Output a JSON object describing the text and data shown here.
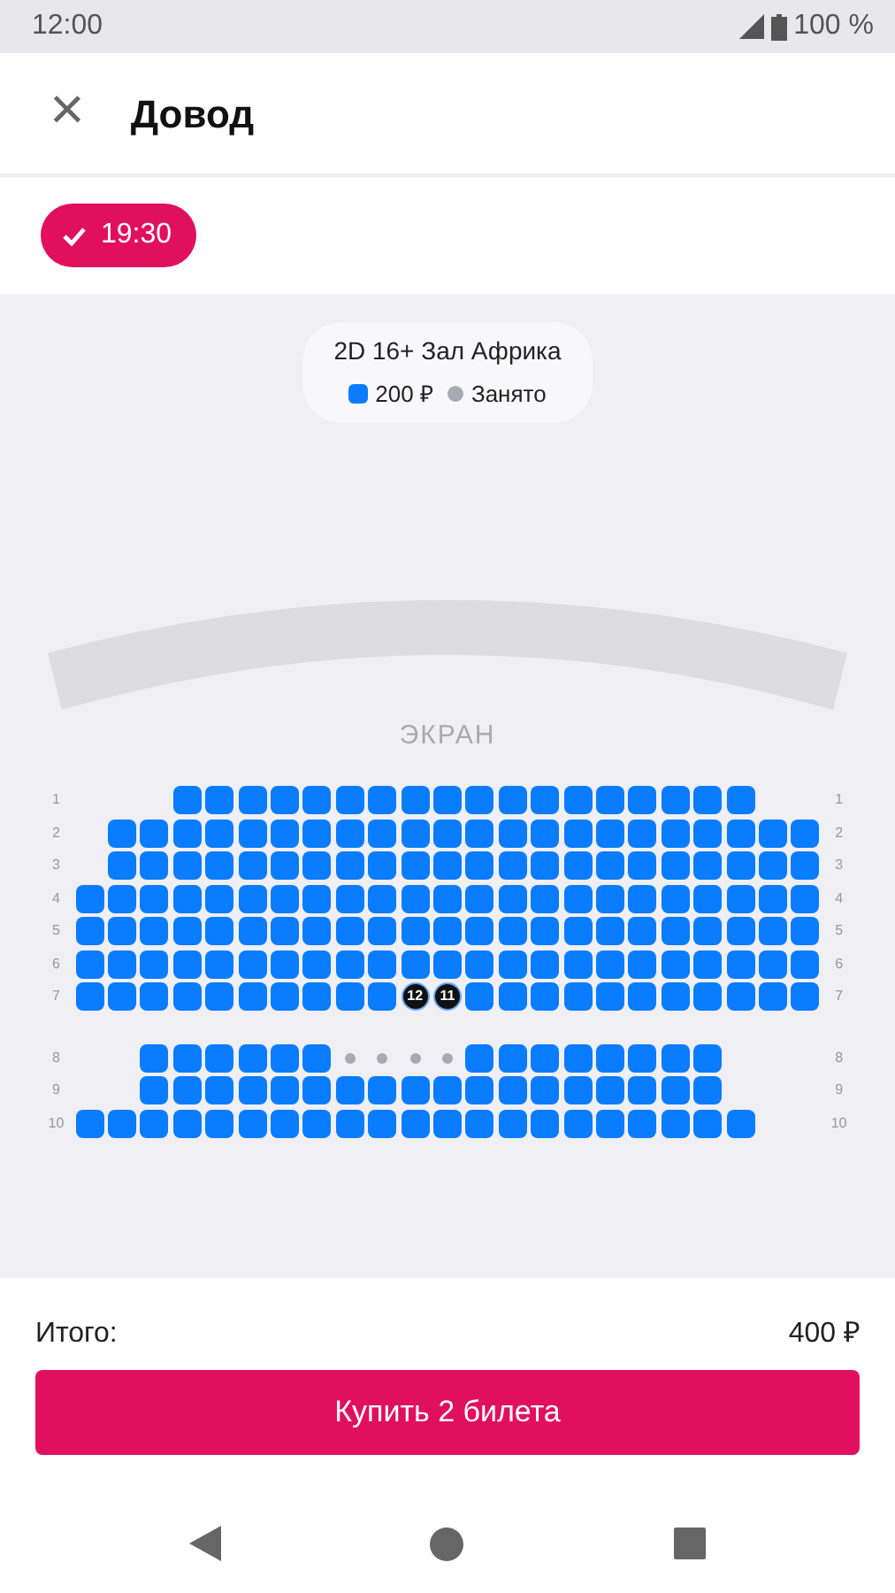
{
  "status_bar": {
    "time": "12:00",
    "battery": "100 %"
  },
  "header": {
    "close": "×",
    "title": "Довод"
  },
  "sessions": [
    {
      "time": "19:30",
      "selected": true
    }
  ],
  "hall_info": {
    "title": "2D 16+ Зал Африка",
    "legend": [
      {
        "kind": "price",
        "label": "200 ₽",
        "color": "#0a7cff"
      },
      {
        "kind": "taken",
        "label": "Занято",
        "color": "#a9a9b3"
      }
    ]
  },
  "screen_label": "ЭКРАН",
  "sections": [
    {
      "rows": [
        {
          "left_label": "1",
          "right_label": "1",
          "seats": [
            {
              "kind": "gap"
            },
            {
              "kind": "gap"
            },
            {
              "kind": "gap"
            },
            {
              "kind": "free"
            },
            {
              "kind": "free"
            },
            {
              "kind": "free"
            },
            {
              "kind": "free"
            },
            {
              "kind": "free"
            },
            {
              "kind": "free"
            },
            {
              "kind": "free"
            },
            {
              "kind": "free"
            },
            {
              "kind": "free"
            },
            {
              "kind": "free"
            },
            {
              "kind": "free"
            },
            {
              "kind": "free"
            },
            {
              "kind": "free"
            },
            {
              "kind": "free"
            },
            {
              "kind": "free"
            },
            {
              "kind": "free"
            },
            {
              "kind": "free"
            },
            {
              "kind": "free"
            }
          ]
        },
        {
          "left_label": "2",
          "right_label": "2",
          "seats": [
            {
              "kind": "gap"
            },
            {
              "kind": "free"
            },
            {
              "kind": "free"
            },
            {
              "kind": "free"
            },
            {
              "kind": "free"
            },
            {
              "kind": "free"
            },
            {
              "kind": "free"
            },
            {
              "kind": "free"
            },
            {
              "kind": "free"
            },
            {
              "kind": "free"
            },
            {
              "kind": "free"
            },
            {
              "kind": "free"
            },
            {
              "kind": "free"
            },
            {
              "kind": "free"
            },
            {
              "kind": "free"
            },
            {
              "kind": "free"
            },
            {
              "kind": "free"
            },
            {
              "kind": "free"
            },
            {
              "kind": "free"
            },
            {
              "kind": "free"
            },
            {
              "kind": "free"
            },
            {
              "kind": "free"
            },
            {
              "kind": "free"
            }
          ]
        },
        {
          "left_label": "3",
          "right_label": "3",
          "seats": [
            {
              "kind": "gap"
            },
            {
              "kind": "free"
            },
            {
              "kind": "free"
            },
            {
              "kind": "free"
            },
            {
              "kind": "free"
            },
            {
              "kind": "free"
            },
            {
              "kind": "free"
            },
            {
              "kind": "free"
            },
            {
              "kind": "free"
            },
            {
              "kind": "free"
            },
            {
              "kind": "free"
            },
            {
              "kind": "free"
            },
            {
              "kind": "free"
            },
            {
              "kind": "free"
            },
            {
              "kind": "free"
            },
            {
              "kind": "free"
            },
            {
              "kind": "free"
            },
            {
              "kind": "free"
            },
            {
              "kind": "free"
            },
            {
              "kind": "free"
            },
            {
              "kind": "free"
            },
            {
              "kind": "free"
            },
            {
              "kind": "free"
            }
          ]
        },
        {
          "left_label": "4",
          "right_label": "4",
          "seats": [
            {
              "kind": "free"
            },
            {
              "kind": "free"
            },
            {
              "kind": "free"
            },
            {
              "kind": "free"
            },
            {
              "kind": "free"
            },
            {
              "kind": "free"
            },
            {
              "kind": "free"
            },
            {
              "kind": "free"
            },
            {
              "kind": "free"
            },
            {
              "kind": "free"
            },
            {
              "kind": "free"
            },
            {
              "kind": "free"
            },
            {
              "kind": "free"
            },
            {
              "kind": "free"
            },
            {
              "kind": "free"
            },
            {
              "kind": "free"
            },
            {
              "kind": "free"
            },
            {
              "kind": "free"
            },
            {
              "kind": "free"
            },
            {
              "kind": "free"
            },
            {
              "kind": "free"
            },
            {
              "kind": "free"
            },
            {
              "kind": "free"
            }
          ]
        },
        {
          "left_label": "5",
          "right_label": "5",
          "seats": [
            {
              "kind": "free"
            },
            {
              "kind": "free"
            },
            {
              "kind": "free"
            },
            {
              "kind": "free"
            },
            {
              "kind": "free"
            },
            {
              "kind": "free"
            },
            {
              "kind": "free"
            },
            {
              "kind": "free"
            },
            {
              "kind": "free"
            },
            {
              "kind": "free"
            },
            {
              "kind": "free"
            },
            {
              "kind": "free"
            },
            {
              "kind": "free"
            },
            {
              "kind": "free"
            },
            {
              "kind": "free"
            },
            {
              "kind": "free"
            },
            {
              "kind": "free"
            },
            {
              "kind": "free"
            },
            {
              "kind": "free"
            },
            {
              "kind": "free"
            },
            {
              "kind": "free"
            },
            {
              "kind": "free"
            },
            {
              "kind": "free"
            }
          ]
        },
        {
          "left_label": "6",
          "right_label": "6",
          "seats": [
            {
              "kind": "free"
            },
            {
              "kind": "free"
            },
            {
              "kind": "free"
            },
            {
              "kind": "free"
            },
            {
              "kind": "free"
            },
            {
              "kind": "free"
            },
            {
              "kind": "free"
            },
            {
              "kind": "free"
            },
            {
              "kind": "free"
            },
            {
              "kind": "free"
            },
            {
              "kind": "free"
            },
            {
              "kind": "free"
            },
            {
              "kind": "free"
            },
            {
              "kind": "free"
            },
            {
              "kind": "free"
            },
            {
              "kind": "free"
            },
            {
              "kind": "free"
            },
            {
              "kind": "free"
            },
            {
              "kind": "free"
            },
            {
              "kind": "free"
            },
            {
              "kind": "free"
            },
            {
              "kind": "free"
            },
            {
              "kind": "free"
            }
          ]
        },
        {
          "left_label": "7",
          "right_label": "7",
          "seats": [
            {
              "kind": "free"
            },
            {
              "kind": "free"
            },
            {
              "kind": "free"
            },
            {
              "kind": "free"
            },
            {
              "kind": "free"
            },
            {
              "kind": "free"
            },
            {
              "kind": "free"
            },
            {
              "kind": "free"
            },
            {
              "kind": "free"
            },
            {
              "kind": "free"
            },
            {
              "kind": "selected",
              "number": "12"
            },
            {
              "kind": "selected",
              "number": "11"
            },
            {
              "kind": "free"
            },
            {
              "kind": "free"
            },
            {
              "kind": "free"
            },
            {
              "kind": "free"
            },
            {
              "kind": "free"
            },
            {
              "kind": "free"
            },
            {
              "kind": "free"
            },
            {
              "kind": "free"
            },
            {
              "kind": "free"
            },
            {
              "kind": "free"
            },
            {
              "kind": "free"
            }
          ]
        }
      ]
    },
    {
      "rows": [
        {
          "left_label": "8",
          "right_label": "8",
          "seats": [
            {
              "kind": "gap"
            },
            {
              "kind": "gap"
            },
            {
              "kind": "free"
            },
            {
              "kind": "free"
            },
            {
              "kind": "free"
            },
            {
              "kind": "free"
            },
            {
              "kind": "free"
            },
            {
              "kind": "free"
            },
            {
              "kind": "taken"
            },
            {
              "kind": "taken"
            },
            {
              "kind": "taken"
            },
            {
              "kind": "taken"
            },
            {
              "kind": "free"
            },
            {
              "kind": "free"
            },
            {
              "kind": "free"
            },
            {
              "kind": "free"
            },
            {
              "kind": "free"
            },
            {
              "kind": "free"
            },
            {
              "kind": "free"
            },
            {
              "kind": "free"
            }
          ]
        },
        {
          "left_label": "9",
          "right_label": "9",
          "seats": [
            {
              "kind": "gap"
            },
            {
              "kind": "gap"
            },
            {
              "kind": "free"
            },
            {
              "kind": "free"
            },
            {
              "kind": "free"
            },
            {
              "kind": "free"
            },
            {
              "kind": "free"
            },
            {
              "kind": "free"
            },
            {
              "kind": "free"
            },
            {
              "kind": "free"
            },
            {
              "kind": "free"
            },
            {
              "kind": "free"
            },
            {
              "kind": "free"
            },
            {
              "kind": "free"
            },
            {
              "kind": "free"
            },
            {
              "kind": "free"
            },
            {
              "kind": "free"
            },
            {
              "kind": "free"
            },
            {
              "kind": "free"
            },
            {
              "kind": "free"
            }
          ]
        },
        {
          "left_label": "10",
          "right_label": "10",
          "seats": [
            {
              "kind": "free"
            },
            {
              "kind": "free"
            },
            {
              "kind": "free"
            },
            {
              "kind": "free"
            },
            {
              "kind": "free"
            },
            {
              "kind": "free"
            },
            {
              "kind": "free"
            },
            {
              "kind": "free"
            },
            {
              "kind": "free"
            },
            {
              "kind": "free"
            },
            {
              "kind": "free"
            },
            {
              "kind": "free"
            },
            {
              "kind": "free"
            },
            {
              "kind": "free"
            },
            {
              "kind": "free"
            },
            {
              "kind": "free"
            },
            {
              "kind": "free"
            },
            {
              "kind": "free"
            },
            {
              "kind": "free"
            },
            {
              "kind": "free"
            },
            {
              "kind": "free"
            }
          ]
        }
      ]
    }
  ],
  "total": {
    "label": "Итого:",
    "amount": "400 ₽"
  },
  "buy_button": "Купить 2 билета"
}
